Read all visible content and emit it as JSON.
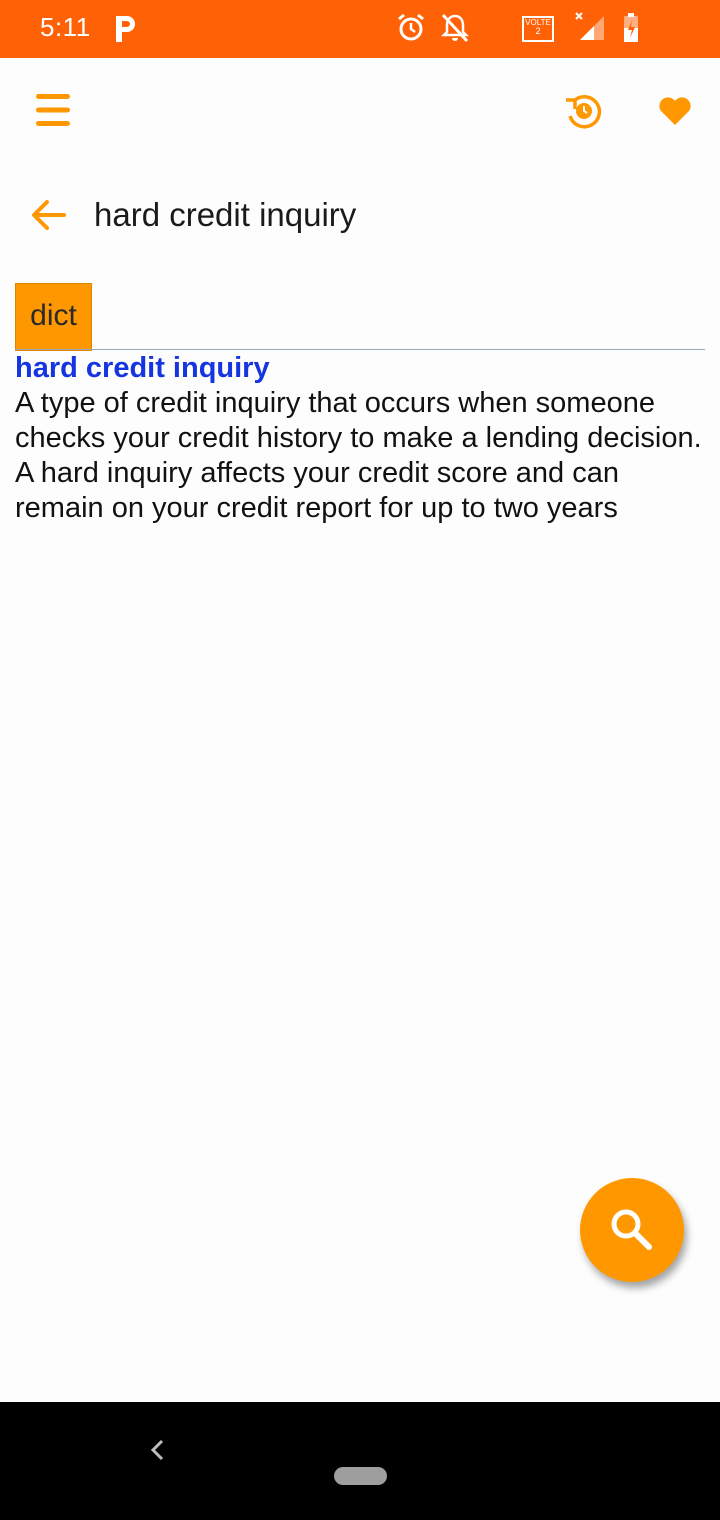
{
  "status_bar": {
    "time": "5:11",
    "background": "#ff6106",
    "icons": [
      "parking-icon",
      "alarm-icon",
      "notifications-off-icon",
      "volte-icon",
      "signal-icon",
      "battery-icon"
    ],
    "volte_label": "VOLTE",
    "sim_number": "2"
  },
  "app_bar": {
    "icons": [
      "menu-icon",
      "history-icon",
      "heart-icon"
    ],
    "accent": "#ff9800"
  },
  "search": {
    "query": "hard credit inquiry"
  },
  "tabs": [
    {
      "label": "dict",
      "active": true
    }
  ],
  "entry": {
    "term": "hard credit inquiry",
    "definition_lines": [
      "A type of credit inquiry that occurs when someone checks your credit history to make a lending decision.",
      "A hard inquiry affects your credit score and can remain on your credit report for up to two years"
    ],
    "term_color": "#1535e0"
  },
  "fab": {
    "icon": "search-icon"
  },
  "nav_bar": {
    "icons": [
      "nav-back-icon",
      "nav-home-pill"
    ]
  }
}
